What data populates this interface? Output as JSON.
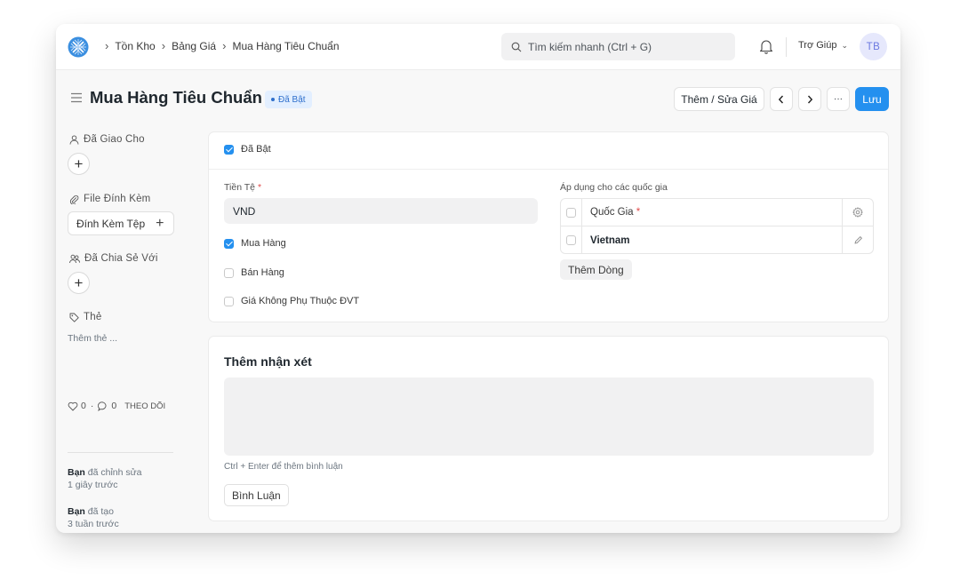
{
  "topbar": {
    "breadcrumbs": [
      "Tồn Kho",
      "Bảng Giá",
      "Mua Hàng Tiêu Chuẩn"
    ],
    "search_placeholder": "Tìm kiếm nhanh (Ctrl + G)",
    "help_label": "Trợ Giúp",
    "avatar_initials": "TB"
  },
  "header": {
    "title": "Mua Hàng Tiêu Chuẩn",
    "status": "Đã Bật",
    "add_edit_price_label": "Thêm / Sửa Giá",
    "prev_icon": "chevron-left-icon",
    "next_icon": "chevron-right-icon",
    "more_label": "···",
    "save_label": "Lưu"
  },
  "sidebar": {
    "assigned_to_label": "Đã Giao Cho",
    "attachments_label": "File Đính Kèm",
    "attach_button_label": "Đính Kèm Tệp",
    "shared_with_label": "Đã Chia Sẻ Với",
    "tags_label": "Thẻ",
    "add_tag_placeholder": "Thêm thẻ ...",
    "likes_count": "0",
    "comments_count": "0",
    "follow_label": "THEO DÕI",
    "activity": [
      {
        "who": "Bạn",
        "action": "đã chỉnh sửa",
        "when": "1 giây trước"
      },
      {
        "who": "Bạn",
        "action": "đã tạo",
        "when": "3 tuần trước"
      }
    ]
  },
  "form": {
    "enabled_label": "Đã Bật",
    "enabled_checked": true,
    "currency_label": "Tiền Tệ",
    "currency_value": "VND",
    "buying_label": "Mua Hàng",
    "buying_checked": true,
    "selling_label": "Bán Hàng",
    "selling_checked": false,
    "uom_independent_label": "Giá Không Phụ Thuộc ĐVT",
    "uom_independent_checked": false,
    "countries_label": "Áp dụng cho các quốc gia",
    "countries_table": {
      "column_header": "Quốc Gia",
      "rows": [
        {
          "country": "Vietnam"
        }
      ]
    },
    "add_row_label": "Thêm Dòng"
  },
  "comments": {
    "title": "Thêm nhận xét",
    "hint": "Ctrl + Enter để thêm bình luận",
    "submit_label": "Bình Luận"
  },
  "colors": {
    "primary": "#2490ef",
    "badge_bg": "#e3efff",
    "badge_text": "#2f6fcc",
    "required": "#e24c4c"
  }
}
